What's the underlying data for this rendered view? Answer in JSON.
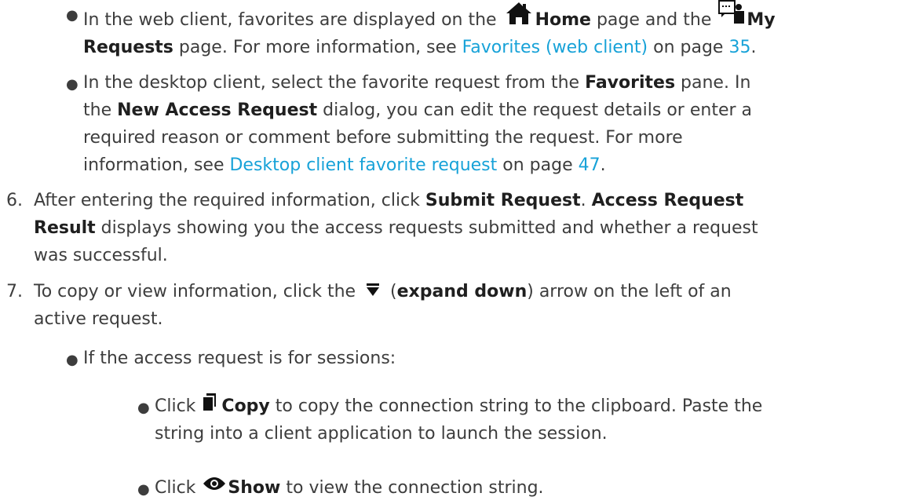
{
  "bullets_level2": [
    {
      "parts": [
        "In the web client, favorites are displayed on the ",
        "Home",
        " page and the ",
        "My",
        "Requests",
        " page. For more information, see ",
        "Favorites (web client)",
        " on page ",
        "35",
        "."
      ]
    },
    {
      "parts": [
        "In the desktop client, select the favorite request from the ",
        "Favorites",
        " pane. In",
        "the ",
        "New Access Request",
        " dialog, you can edit the request details or enter a",
        "required reason or comment before submitting the request. For more",
        "information, see ",
        "Desktop client favorite request",
        " on page ",
        "47",
        "."
      ]
    }
  ],
  "steps": [
    {
      "number": "6.",
      "parts": [
        "After entering the required information, click ",
        "Submit Request",
        ". ",
        "Access Request",
        "Result",
        " displays showing you the access requests submitted and whether a request",
        "was successful."
      ]
    },
    {
      "number": "7.",
      "parts": [
        "To copy or view information, click the ",
        " (",
        "expand down",
        ") arrow on the left of an",
        "active request."
      ]
    }
  ],
  "sub_bullet": "If the access request is for sessions:",
  "sub_sub_bullets": [
    {
      "parts": [
        "Click ",
        "Copy",
        " to copy the connection string to the clipboard. Paste the",
        "string into a client application to launch the session."
      ]
    },
    {
      "parts": [
        "Click ",
        "Show",
        " to view the connection string."
      ]
    }
  ],
  "icons": {
    "home": "home-icon",
    "my_requests": "my-requests-icon",
    "expand_down": "expand-down-icon",
    "copy": "copy-icon",
    "show": "eye-icon"
  },
  "colors": {
    "text": "#3d3d3d",
    "bold": "#1f1f1f",
    "link": "#17a2d8"
  }
}
